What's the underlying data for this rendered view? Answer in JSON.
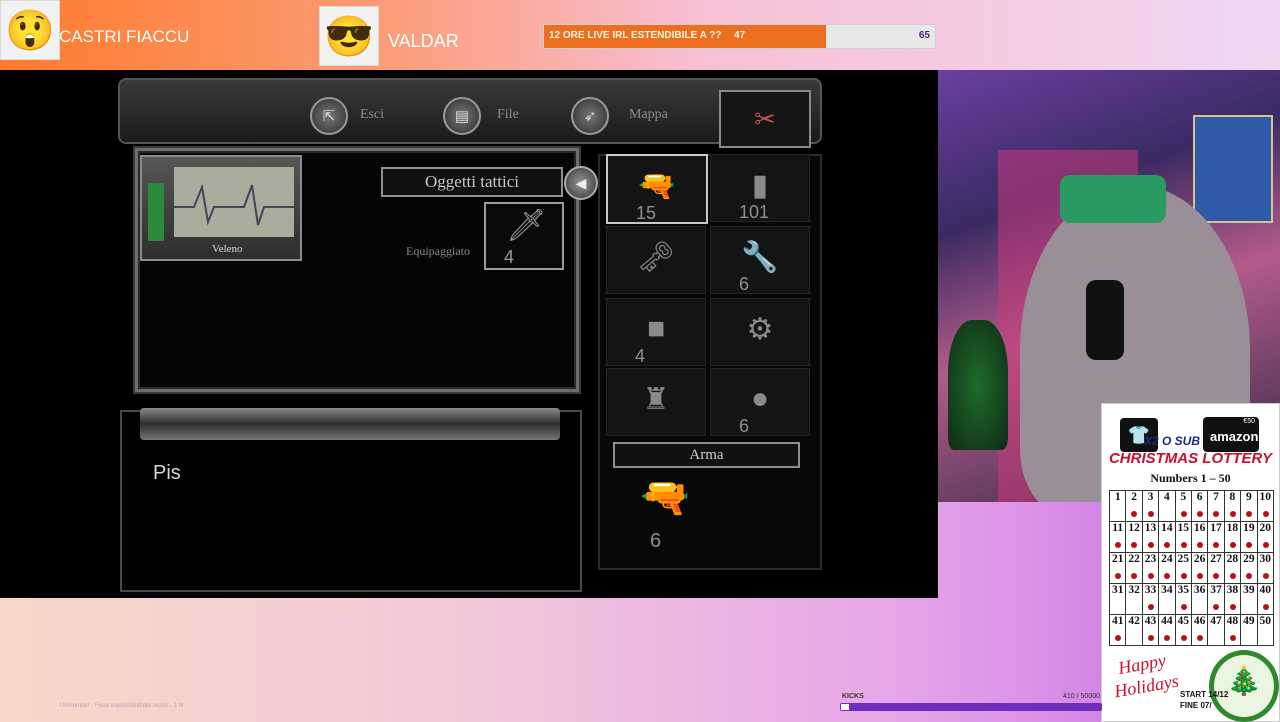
{
  "header": {
    "user1_name": "CASTRI FIACCU",
    "user2_name": "VALDAR",
    "goal_label": "12 ORE LIVE IRL ESTENDIBILE A ??",
    "goal_current": "47",
    "goal_target": "65",
    "goal_progress": 0.72
  },
  "game": {
    "nav": {
      "exit": "Esci",
      "file": "File",
      "map": "Mappa"
    },
    "status_label": "Veleno",
    "tactical_title": "Oggetti tattici",
    "equipped_label": "Equipaggiato",
    "equipped_count": "4",
    "description_text": "Pis",
    "weapon_title": "Arma",
    "weapon_count": "6",
    "inventory": [
      {
        "icon": "pistol-icon",
        "count": "15"
      },
      {
        "icon": "ammo-magazine-icon",
        "count": "101"
      },
      {
        "icon": "key-icon",
        "count": ""
      },
      {
        "icon": "shotgun-icon",
        "count": "6"
      },
      {
        "icon": "ammo-box-icon",
        "count": "4"
      },
      {
        "icon": "crank-handle-icon",
        "count": ""
      },
      {
        "icon": "spray-icon",
        "count": ""
      },
      {
        "icon": "shells-icon",
        "count": "6"
      }
    ]
  },
  "lottery": {
    "badge": "X2 O SUB",
    "brand": "amazon",
    "voucher": "€50",
    "title": "CHRISTMAS LOTTERY",
    "subtitle": "Numbers 1 – 50",
    "numbers": [
      "1",
      "2",
      "3",
      "4",
      "5",
      "6",
      "7",
      "8",
      "9",
      "10",
      "11",
      "12",
      "13",
      "14",
      "15",
      "16",
      "17",
      "18",
      "19",
      "20",
      "21",
      "22",
      "23",
      "24",
      "25",
      "26",
      "27",
      "28",
      "29",
      "30",
      "31",
      "32",
      "33",
      "34",
      "35",
      "36",
      "37",
      "38",
      "39",
      "40",
      "41",
      "42",
      "43",
      "44",
      "45",
      "46",
      "47",
      "48",
      "49",
      "50"
    ],
    "holiday_line1": "Happy",
    "holiday_line2": "Holidays",
    "start_text": "START 14/12",
    "end_text": "FINE 07/"
  },
  "kicks": {
    "label": "KICKS",
    "value": "410 / 50000",
    "progress": 0.008
  },
  "footer": {
    "credit": "Unmember · Fiera sopiatofanttiate nichts · 1 hr"
  },
  "colors": {
    "accent_orange": "#ec6f1f",
    "lottery_red": "#c8102e",
    "kicks_purple": "#6f2dbd"
  }
}
